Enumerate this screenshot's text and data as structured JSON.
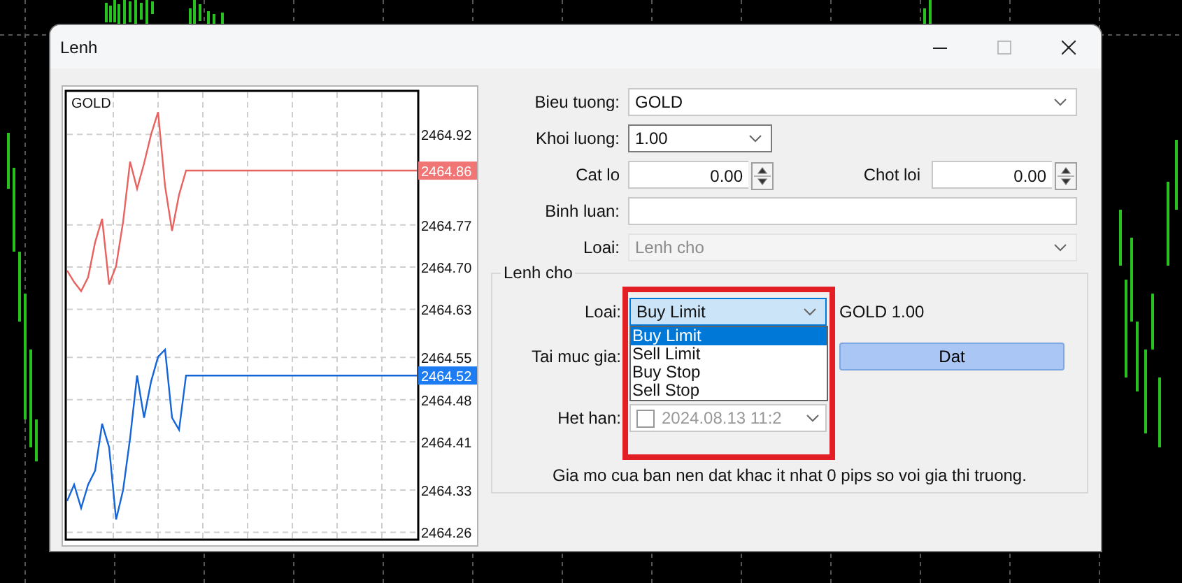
{
  "window": {
    "title": "Lenh"
  },
  "chart": {
    "symbol": "GOLD",
    "chart_data": {
      "type": "line",
      "grid": true,
      "ylim": [
        2464.25,
        2464.99
      ],
      "yticks": [
        {
          "value": 2464.92,
          "label": "2464.92"
        },
        {
          "value": 2464.77,
          "label": "2464.77"
        },
        {
          "value": 2464.7,
          "label": "2464.70"
        },
        {
          "value": 2464.63,
          "label": "2464.63"
        },
        {
          "value": 2464.55,
          "label": "2464.55"
        },
        {
          "value": 2464.48,
          "label": "2464.48"
        },
        {
          "value": 2464.41,
          "label": "2464.41"
        },
        {
          "value": 2464.33,
          "label": "2464.33"
        },
        {
          "value": 2464.26,
          "label": "2464.26"
        }
      ],
      "categories": [
        null,
        null,
        null,
        null,
        null,
        null,
        null,
        null,
        null,
        null,
        null,
        null,
        null,
        null,
        null,
        null,
        null,
        null,
        null,
        null,
        null,
        null,
        null,
        null,
        null,
        null,
        null,
        null,
        null,
        null,
        null,
        null,
        null,
        null,
        null,
        null,
        null,
        null,
        null,
        null,
        null,
        null,
        null,
        null,
        null,
        null,
        null,
        null,
        null,
        null,
        null
      ],
      "series": [
        {
          "color": "#e8625f",
          "values": [
            2464.694,
            2464.675,
            2464.66,
            2464.683,
            2464.741,
            2464.78,
            2464.671,
            2464.702,
            2464.775,
            2464.875,
            2464.83,
            2464.872,
            2464.92,
            2464.957,
            2464.834,
            2464.76,
            2464.82,
            2464.86,
            2464.86,
            2464.86,
            2464.86,
            2464.86,
            2464.86,
            2464.86,
            2464.86,
            2464.86,
            2464.86,
            2464.86,
            2464.86,
            2464.86,
            2464.86,
            2464.86,
            2464.86,
            2464.86,
            2464.86,
            2464.86,
            2464.86,
            2464.86,
            2464.86,
            2464.86,
            2464.86,
            2464.86,
            2464.86,
            2464.86,
            2464.86,
            2464.86,
            2464.86,
            2464.86,
            2464.86,
            2464.86,
            2464.86
          ]
        },
        {
          "color": "#1565d8",
          "values": [
            2464.312,
            2464.339,
            2464.3,
            2464.339,
            2464.362,
            2464.44,
            2464.401,
            2464.281,
            2464.33,
            2464.416,
            2464.52,
            2464.45,
            2464.51,
            2464.551,
            2464.563,
            2464.45,
            2464.43,
            2464.52,
            2464.52,
            2464.52,
            2464.52,
            2464.52,
            2464.52,
            2464.52,
            2464.52,
            2464.52,
            2464.52,
            2464.52,
            2464.52,
            2464.52,
            2464.52,
            2464.52,
            2464.52,
            2464.52,
            2464.52,
            2464.52,
            2464.52,
            2464.52,
            2464.52,
            2464.52,
            2464.52,
            2464.52,
            2464.52,
            2464.52,
            2464.52,
            2464.52,
            2464.52,
            2464.52,
            2464.52,
            2464.52,
            2464.52
          ]
        }
      ]
    },
    "price_tags": [
      {
        "text": "2464.86",
        "color": "#f07575"
      },
      {
        "text": "2464.52",
        "color": "#1e7cf2"
      }
    ]
  },
  "symbol": {
    "label": "Bieu tuong:",
    "value": "GOLD"
  },
  "volume": {
    "label": "Khoi luong:",
    "value": "1.00"
  },
  "stop_loss": {
    "label": "Cat lo",
    "value": "0.00"
  },
  "take_profit": {
    "label": "Chot loi",
    "value": "0.00"
  },
  "comment": {
    "label": "Binh luan:"
  },
  "order_type": {
    "label": "Loai:",
    "value": "Lenh cho",
    "disabled": true
  },
  "pending": {
    "title": "Lenh cho",
    "type": {
      "label": "Loai:",
      "value": "Buy Limit",
      "expanded": true,
      "options": [
        {
          "label": "Buy Limit",
          "selected": true
        },
        {
          "label": "Sell Limit",
          "selected": false
        },
        {
          "label": "Buy Stop",
          "selected": false
        },
        {
          "label": "Sell Stop",
          "selected": false
        }
      ]
    },
    "info": "GOLD 1.00",
    "price_label": "Tai muc gia:",
    "place_button": "Dat",
    "expiry": {
      "label": "Het han:",
      "checked": false,
      "value": "2024.08.13 11:2",
      "disabled": true
    },
    "message": "Gia mo cua ban nen dat khac it nhat 0 pips so voi gia thi truong."
  }
}
